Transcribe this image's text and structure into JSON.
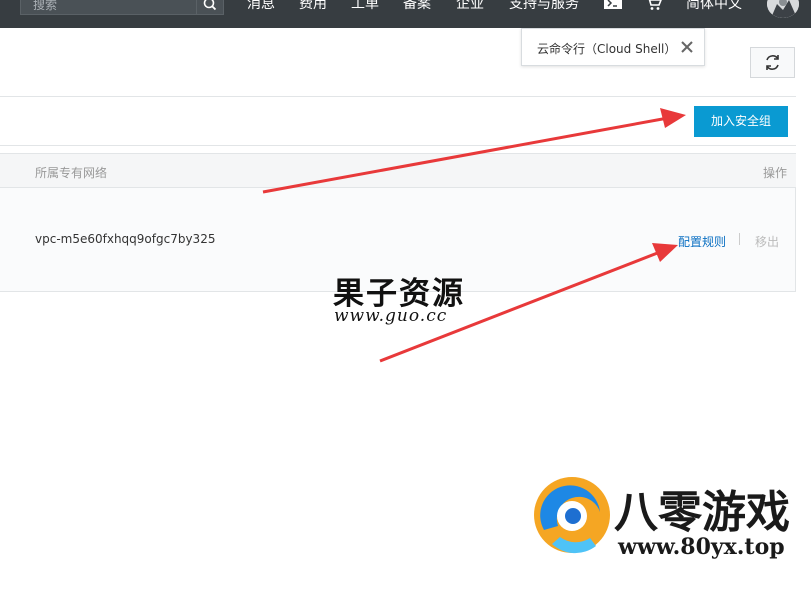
{
  "topbar": {
    "search": {
      "placeholder": "搜索"
    },
    "nav": [
      "消息",
      "费用",
      "工单",
      "备案",
      "企业",
      "支持与服务"
    ],
    "language": "简体中文"
  },
  "tooltip": {
    "text": "云命令行（Cloud Shell）"
  },
  "toolbar": {
    "add_button": "加入安全组"
  },
  "table": {
    "headers": {
      "vpc": "所属专有网络",
      "actions": "操作"
    },
    "rows": [
      {
        "vpc": "vpc-m5e60fxhqq9ofgc7by325",
        "config": "配置规则",
        "remove": "移出"
      }
    ]
  },
  "watermarks": {
    "guozi": {
      "text": "果子资源",
      "url": "www.guo.cc"
    },
    "baling": {
      "text": "八零游戏",
      "url": "www.80yx.top"
    }
  },
  "colors": {
    "topbar": "#373d41",
    "primary": "#0a9ad2",
    "link": "#0a6fc2",
    "arrow": "#e8393a"
  },
  "icons": [
    "search-icon",
    "terminal-icon",
    "cart-icon",
    "avatar",
    "close-icon",
    "refresh-icon"
  ]
}
